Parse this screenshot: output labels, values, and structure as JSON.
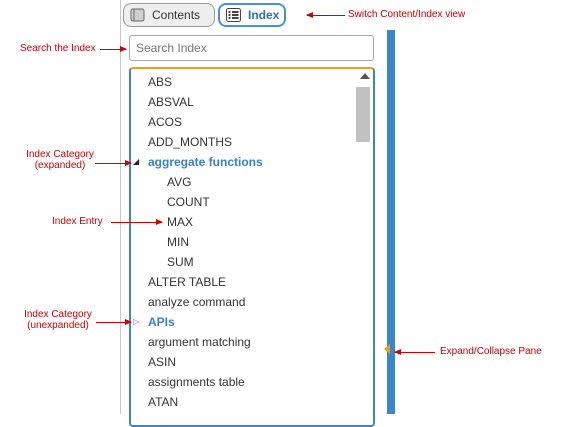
{
  "tabs": {
    "contents_label": "Contents",
    "index_label": "Index",
    "contents_icon": "book-icon",
    "index_icon": "list-icon"
  },
  "search": {
    "placeholder": "Search Index",
    "value": ""
  },
  "index": {
    "items": [
      {
        "label": "ABS",
        "level": 0
      },
      {
        "label": "ABSVAL",
        "level": 0
      },
      {
        "label": "ACOS",
        "level": 0
      },
      {
        "label": "ADD_MONTHS",
        "level": 0
      },
      {
        "label": "aggregate functions",
        "level": 0,
        "category": true,
        "expanded": true
      },
      {
        "label": "AVG",
        "level": 1
      },
      {
        "label": "COUNT",
        "level": 1
      },
      {
        "label": "MAX",
        "level": 1
      },
      {
        "label": "MIN",
        "level": 1
      },
      {
        "label": "SUM",
        "level": 1
      },
      {
        "label": "ALTER TABLE",
        "level": 0
      },
      {
        "label": "analyze command",
        "level": 0
      },
      {
        "label": "APIs",
        "level": 0,
        "category": true,
        "expanded": false
      },
      {
        "label": "argument matching",
        "level": 0
      },
      {
        "label": "ASIN",
        "level": 0
      },
      {
        "label": "assignments table",
        "level": 0
      },
      {
        "label": "ATAN",
        "level": 0
      }
    ]
  },
  "annotations": {
    "switch_view": "Switch Content/Index view",
    "search_index": "Search the Index",
    "category_expanded": [
      "Index Category",
      "(expanded)"
    ],
    "index_entry": "Index Entry",
    "category_unexpanded": [
      "Index Category",
      "(unexpanded)"
    ],
    "expand_collapse": "Expand/Collapse Pane"
  },
  "colors": {
    "accent": "#3a86c8",
    "category_text": "#3a7fc8",
    "annotation": "#cc0000",
    "handle": "#e8a020"
  }
}
